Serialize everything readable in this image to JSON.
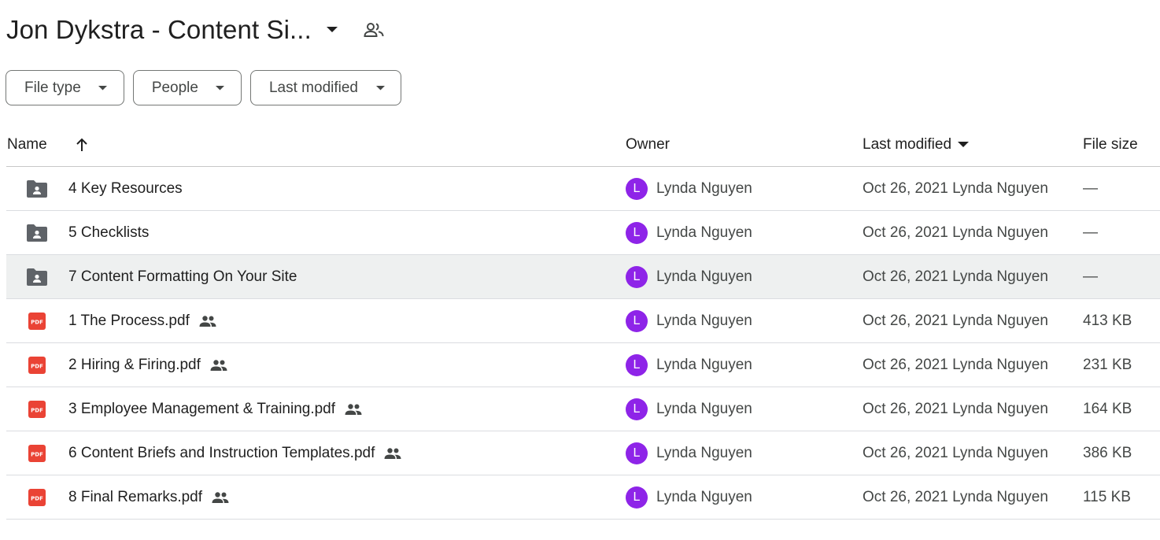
{
  "header": {
    "title": "Jon Dykstra - Content Si...",
    "title_caret_icon": "arrow-drop-down-icon",
    "shared_icon": "people-outline-icon"
  },
  "filters": [
    {
      "label": "File type"
    },
    {
      "label": "People"
    },
    {
      "label": "Last modified"
    }
  ],
  "columns": {
    "name": "Name",
    "owner": "Owner",
    "last_modified": "Last modified",
    "file_size": "File size"
  },
  "colors": {
    "avatar": "#8e24e8",
    "pdf_red": "#ea4335",
    "folder_gray": "#5f6368",
    "selected_row": "#eef0f0"
  },
  "rows": [
    {
      "type": "folder",
      "name": "4 Key Resources",
      "shared": false,
      "owner_initial": "L",
      "owner": "Lynda Nguyen",
      "modified": "Oct 26, 2021 Lynda Nguyen",
      "size": "—",
      "selected": false
    },
    {
      "type": "folder",
      "name": "5 Checklists",
      "shared": false,
      "owner_initial": "L",
      "owner": "Lynda Nguyen",
      "modified": "Oct 26, 2021 Lynda Nguyen",
      "size": "—",
      "selected": false
    },
    {
      "type": "folder",
      "name": "7 Content Formatting On Your Site",
      "shared": false,
      "owner_initial": "L",
      "owner": "Lynda Nguyen",
      "modified": "Oct 26, 2021 Lynda Nguyen",
      "size": "—",
      "selected": true
    },
    {
      "type": "pdf",
      "name": "1 The Process.pdf",
      "shared": true,
      "owner_initial": "L",
      "owner": "Lynda Nguyen",
      "modified": "Oct 26, 2021 Lynda Nguyen",
      "size": "413 KB",
      "selected": false
    },
    {
      "type": "pdf",
      "name": "2 Hiring & Firing.pdf",
      "shared": true,
      "owner_initial": "L",
      "owner": "Lynda Nguyen",
      "modified": "Oct 26, 2021 Lynda Nguyen",
      "size": "231 KB",
      "selected": false
    },
    {
      "type": "pdf",
      "name": "3 Employee Management & Training.pdf",
      "shared": true,
      "owner_initial": "L",
      "owner": "Lynda Nguyen",
      "modified": "Oct 26, 2021 Lynda Nguyen",
      "size": "164 KB",
      "selected": false
    },
    {
      "type": "pdf",
      "name": "6 Content Briefs and Instruction Templates.pdf",
      "shared": true,
      "owner_initial": "L",
      "owner": "Lynda Nguyen",
      "modified": "Oct 26, 2021 Lynda Nguyen",
      "size": "386 KB",
      "selected": false
    },
    {
      "type": "pdf",
      "name": "8  Final Remarks.pdf",
      "shared": true,
      "owner_initial": "L",
      "owner": "Lynda Nguyen",
      "modified": "Oct 26, 2021 Lynda Nguyen",
      "size": "115 KB",
      "selected": false
    }
  ]
}
